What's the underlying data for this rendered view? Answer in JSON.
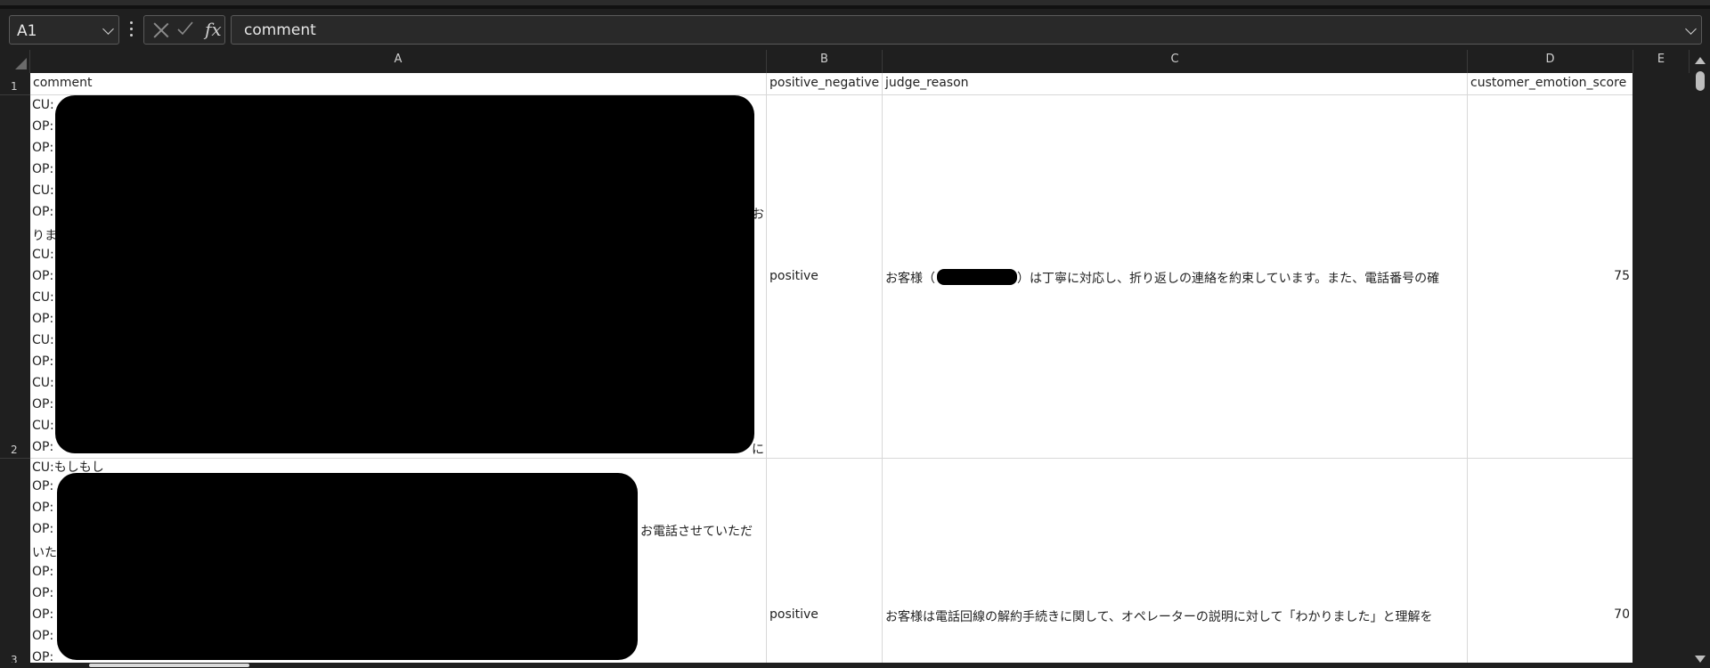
{
  "name_box": {
    "value": "A1"
  },
  "formula_bar": {
    "fx_label": "fx",
    "value": "comment"
  },
  "columns": [
    {
      "letter": "A"
    },
    {
      "letter": "B"
    },
    {
      "letter": "C"
    },
    {
      "letter": "D"
    },
    {
      "letter": "E"
    }
  ],
  "rows": [
    {
      "number": "1"
    },
    {
      "number": "2"
    },
    {
      "number": "3"
    }
  ],
  "header_row": {
    "a": "comment",
    "b": "positive_negative",
    "c": "judge_reason",
    "d": "customer_emotion_score"
  },
  "row2": {
    "lines": [
      "CU:",
      "OP:",
      "OP:",
      "OP:",
      "CU:",
      "OP:",
      "りま",
      "CU:",
      "OP:",
      "CU:",
      "OP:",
      "CU:",
      "OP:",
      "CU:",
      "OP:",
      "CU:",
      "OP:"
    ],
    "overflow_right_a": "お",
    "overflow_right_b": "に",
    "b": "positive",
    "c_before": "お客様（",
    "c_after": "）は丁寧に対応し、折り返しの連絡を約束しています。また、電話番号の確",
    "d": "75"
  },
  "row3": {
    "lines": [
      "CU:もしもし",
      "OP:",
      "OP:",
      "OP:",
      "いた",
      "OP:",
      "OP:",
      "OP:",
      "OP:",
      "OP:"
    ],
    "overflow_right": "お電話させていただ",
    "b": "positive",
    "c": "お客様は電話回線の解約手続きに関して、オペレーターの説明に対して「わかりました」と理解を",
    "d": "70"
  }
}
